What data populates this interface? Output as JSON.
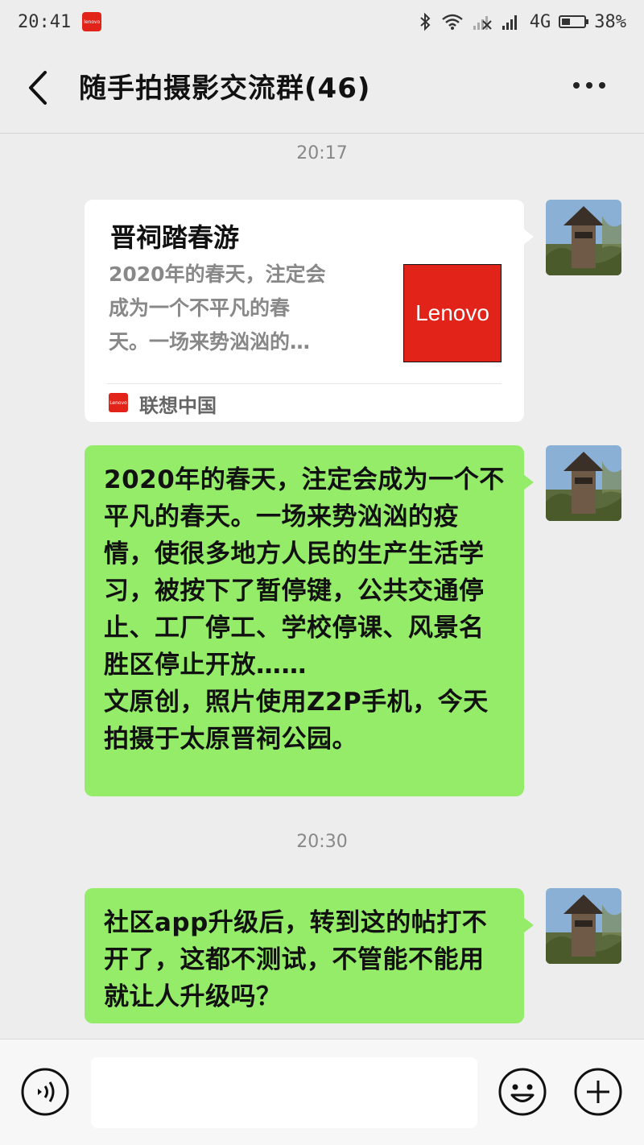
{
  "status_bar": {
    "time": "20:41",
    "brand_mini": "lenovo",
    "network": "4G",
    "battery_percent_label": "38%",
    "battery_level": 0.38
  },
  "header": {
    "title": "随手拍摄影交流群(46)",
    "back_icon": "chevron-left-icon",
    "more_icon": "more-dots-icon"
  },
  "messages": [
    {
      "type": "timestamp",
      "text": "20:17"
    },
    {
      "type": "link_card",
      "title": "晋祠踏春游",
      "description": "2020年的春天，注定会\n成为一个不平凡的春\n天。一场来势汹汹的…",
      "thumbnail_text": "Lenovo",
      "source_logo_text": "Lenovo",
      "source": "联想中国"
    },
    {
      "type": "text",
      "text": "2020年的春天，注定会成为一个不平凡的春天。一场来势汹汹的疫情，使很多地方人民的生产生活学习，被按下了暂停键，公共交通停止、工厂停工、学校停课、风景名胜区停止开放……\n文原创，照片使用Z2P手机，今天拍摄于太原晋祠公园。"
    },
    {
      "type": "timestamp",
      "text": "20:30"
    },
    {
      "type": "text",
      "text": "社区app升级后，转到这的帖打不开了，这都不测试，不管能不能用就让人升级吗？"
    }
  ],
  "input_bar": {
    "voice_icon": "voice-icon",
    "emoji_icon": "emoji-icon",
    "plus_icon": "plus-icon",
    "value": "",
    "placeholder": ""
  },
  "colors": {
    "background": "#ededed",
    "my_bubble": "#95ec69",
    "card_bubble": "#ffffff",
    "lenovo_red": "#e2231a"
  }
}
